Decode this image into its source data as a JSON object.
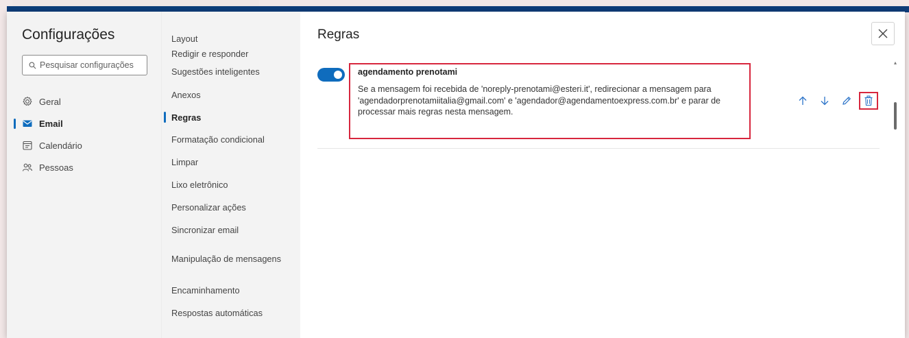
{
  "settings": {
    "title": "Configurações",
    "search_placeholder": "Pesquisar configurações",
    "categories": [
      {
        "label": "Geral",
        "icon": "gear-icon",
        "active": false
      },
      {
        "label": "Email",
        "icon": "mail-icon",
        "active": true
      },
      {
        "label": "Calendário",
        "icon": "calendar-icon",
        "active": false
      },
      {
        "label": "Pessoas",
        "icon": "people-icon",
        "active": false
      }
    ]
  },
  "email_menu": {
    "items": [
      {
        "label": "Layout"
      },
      {
        "label": "Redigir e responder"
      },
      {
        "label": "Sugestões inteligentes"
      },
      {
        "label": "Anexos"
      },
      {
        "label": "Regras",
        "active": true
      },
      {
        "label": "Formatação condicional"
      },
      {
        "label": "Limpar"
      },
      {
        "label": "Lixo eletrônico"
      },
      {
        "label": "Personalizar ações"
      },
      {
        "label": "Sincronizar email"
      },
      {
        "label": "Manipulação de mensagens"
      },
      {
        "label": "Encaminhamento"
      },
      {
        "label": "Respostas automáticas"
      }
    ]
  },
  "rules_page": {
    "title": "Regras",
    "rule": {
      "enabled": true,
      "name": "agendamento prenotami",
      "description": "Se a mensagem foi recebida de 'noreply-prenotami@esteri.it', redirecionar a mensagem para 'agendadorprenotamiitalia@gmail.com' e 'agendador@agendamentoexpress.com.br' e parar de processar mais regras nesta mensagem."
    }
  },
  "colors": {
    "accent": "#0f6cbd",
    "highlight": "#d7263d",
    "panel": "#f3f3f3"
  }
}
